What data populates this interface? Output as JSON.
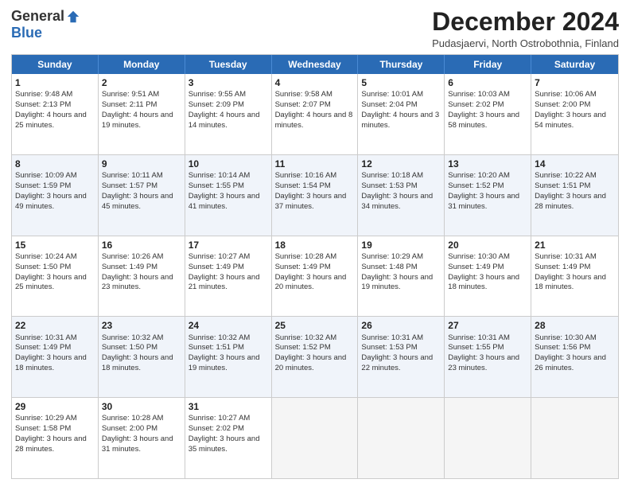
{
  "header": {
    "logo_general": "General",
    "logo_blue": "Blue",
    "title": "December 2024",
    "location": "Pudasjaervi, North Ostrobothnia, Finland"
  },
  "weekdays": [
    "Sunday",
    "Monday",
    "Tuesday",
    "Wednesday",
    "Thursday",
    "Friday",
    "Saturday"
  ],
  "weeks": [
    {
      "alt": false,
      "days": [
        {
          "num": "1",
          "sunrise": "Sunrise: 9:48 AM",
          "sunset": "Sunset: 2:13 PM",
          "daylight": "Daylight: 4 hours and 25 minutes."
        },
        {
          "num": "2",
          "sunrise": "Sunrise: 9:51 AM",
          "sunset": "Sunset: 2:11 PM",
          "daylight": "Daylight: 4 hours and 19 minutes."
        },
        {
          "num": "3",
          "sunrise": "Sunrise: 9:55 AM",
          "sunset": "Sunset: 2:09 PM",
          "daylight": "Daylight: 4 hours and 14 minutes."
        },
        {
          "num": "4",
          "sunrise": "Sunrise: 9:58 AM",
          "sunset": "Sunset: 2:07 PM",
          "daylight": "Daylight: 4 hours and 8 minutes."
        },
        {
          "num": "5",
          "sunrise": "Sunrise: 10:01 AM",
          "sunset": "Sunset: 2:04 PM",
          "daylight": "Daylight: 4 hours and 3 minutes."
        },
        {
          "num": "6",
          "sunrise": "Sunrise: 10:03 AM",
          "sunset": "Sunset: 2:02 PM",
          "daylight": "Daylight: 3 hours and 58 minutes."
        },
        {
          "num": "7",
          "sunrise": "Sunrise: 10:06 AM",
          "sunset": "Sunset: 2:00 PM",
          "daylight": "Daylight: 3 hours and 54 minutes."
        }
      ]
    },
    {
      "alt": true,
      "days": [
        {
          "num": "8",
          "sunrise": "Sunrise: 10:09 AM",
          "sunset": "Sunset: 1:59 PM",
          "daylight": "Daylight: 3 hours and 49 minutes."
        },
        {
          "num": "9",
          "sunrise": "Sunrise: 10:11 AM",
          "sunset": "Sunset: 1:57 PM",
          "daylight": "Daylight: 3 hours and 45 minutes."
        },
        {
          "num": "10",
          "sunrise": "Sunrise: 10:14 AM",
          "sunset": "Sunset: 1:55 PM",
          "daylight": "Daylight: 3 hours and 41 minutes."
        },
        {
          "num": "11",
          "sunrise": "Sunrise: 10:16 AM",
          "sunset": "Sunset: 1:54 PM",
          "daylight": "Daylight: 3 hours and 37 minutes."
        },
        {
          "num": "12",
          "sunrise": "Sunrise: 10:18 AM",
          "sunset": "Sunset: 1:53 PM",
          "daylight": "Daylight: 3 hours and 34 minutes."
        },
        {
          "num": "13",
          "sunrise": "Sunrise: 10:20 AM",
          "sunset": "Sunset: 1:52 PM",
          "daylight": "Daylight: 3 hours and 31 minutes."
        },
        {
          "num": "14",
          "sunrise": "Sunrise: 10:22 AM",
          "sunset": "Sunset: 1:51 PM",
          "daylight": "Daylight: 3 hours and 28 minutes."
        }
      ]
    },
    {
      "alt": false,
      "days": [
        {
          "num": "15",
          "sunrise": "Sunrise: 10:24 AM",
          "sunset": "Sunset: 1:50 PM",
          "daylight": "Daylight: 3 hours and 25 minutes."
        },
        {
          "num": "16",
          "sunrise": "Sunrise: 10:26 AM",
          "sunset": "Sunset: 1:49 PM",
          "daylight": "Daylight: 3 hours and 23 minutes."
        },
        {
          "num": "17",
          "sunrise": "Sunrise: 10:27 AM",
          "sunset": "Sunset: 1:49 PM",
          "daylight": "Daylight: 3 hours and 21 minutes."
        },
        {
          "num": "18",
          "sunrise": "Sunrise: 10:28 AM",
          "sunset": "Sunset: 1:49 PM",
          "daylight": "Daylight: 3 hours and 20 minutes."
        },
        {
          "num": "19",
          "sunrise": "Sunrise: 10:29 AM",
          "sunset": "Sunset: 1:48 PM",
          "daylight": "Daylight: 3 hours and 19 minutes."
        },
        {
          "num": "20",
          "sunrise": "Sunrise: 10:30 AM",
          "sunset": "Sunset: 1:49 PM",
          "daylight": "Daylight: 3 hours and 18 minutes."
        },
        {
          "num": "21",
          "sunrise": "Sunrise: 10:31 AM",
          "sunset": "Sunset: 1:49 PM",
          "daylight": "Daylight: 3 hours and 18 minutes."
        }
      ]
    },
    {
      "alt": true,
      "days": [
        {
          "num": "22",
          "sunrise": "Sunrise: 10:31 AM",
          "sunset": "Sunset: 1:49 PM",
          "daylight": "Daylight: 3 hours and 18 minutes."
        },
        {
          "num": "23",
          "sunrise": "Sunrise: 10:32 AM",
          "sunset": "Sunset: 1:50 PM",
          "daylight": "Daylight: 3 hours and 18 minutes."
        },
        {
          "num": "24",
          "sunrise": "Sunrise: 10:32 AM",
          "sunset": "Sunset: 1:51 PM",
          "daylight": "Daylight: 3 hours and 19 minutes."
        },
        {
          "num": "25",
          "sunrise": "Sunrise: 10:32 AM",
          "sunset": "Sunset: 1:52 PM",
          "daylight": "Daylight: 3 hours and 20 minutes."
        },
        {
          "num": "26",
          "sunrise": "Sunrise: 10:31 AM",
          "sunset": "Sunset: 1:53 PM",
          "daylight": "Daylight: 3 hours and 22 minutes."
        },
        {
          "num": "27",
          "sunrise": "Sunrise: 10:31 AM",
          "sunset": "Sunset: 1:55 PM",
          "daylight": "Daylight: 3 hours and 23 minutes."
        },
        {
          "num": "28",
          "sunrise": "Sunrise: 10:30 AM",
          "sunset": "Sunset: 1:56 PM",
          "daylight": "Daylight: 3 hours and 26 minutes."
        }
      ]
    },
    {
      "alt": false,
      "days": [
        {
          "num": "29",
          "sunrise": "Sunrise: 10:29 AM",
          "sunset": "Sunset: 1:58 PM",
          "daylight": "Daylight: 3 hours and 28 minutes."
        },
        {
          "num": "30",
          "sunrise": "Sunrise: 10:28 AM",
          "sunset": "Sunset: 2:00 PM",
          "daylight": "Daylight: 3 hours and 31 minutes."
        },
        {
          "num": "31",
          "sunrise": "Sunrise: 10:27 AM",
          "sunset": "Sunset: 2:02 PM",
          "daylight": "Daylight: 3 hours and 35 minutes."
        },
        null,
        null,
        null,
        null
      ]
    }
  ]
}
